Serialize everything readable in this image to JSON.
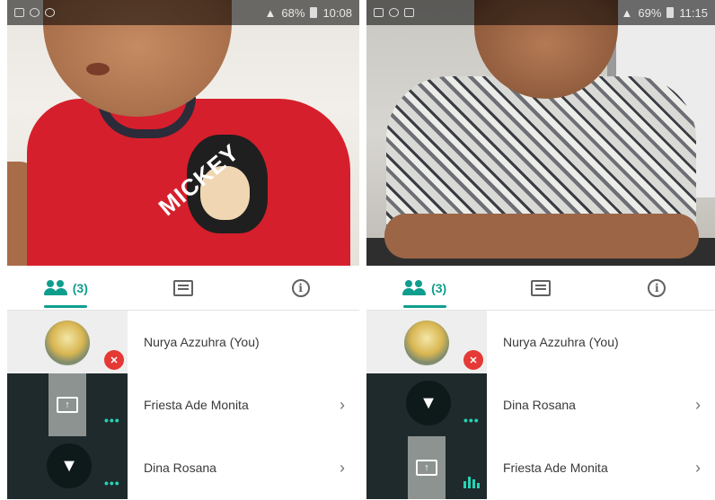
{
  "panels": [
    {
      "status": {
        "battery": "68%",
        "time": "10:08"
      },
      "tabs": {
        "participants_count": "(3)"
      },
      "participants": [
        {
          "name": "Nurya Azzuhra (You)",
          "thumb": "avatar",
          "indicator": "muted-mic"
        },
        {
          "name": "Friesta Ade Monita",
          "thumb": "screen-share",
          "indicator": "dots",
          "chevron": "›"
        },
        {
          "name": "Dina Rosana",
          "thumb": "pin",
          "indicator": "dots",
          "chevron": "›"
        }
      ],
      "video_caption": "MICKEY"
    },
    {
      "status": {
        "battery": "69%",
        "time": "11:15"
      },
      "tabs": {
        "participants_count": "(3)"
      },
      "participants": [
        {
          "name": "Nurya Azzuhra (You)",
          "thumb": "avatar",
          "indicator": "muted-mic"
        },
        {
          "name": "Dina Rosana",
          "thumb": "pin",
          "indicator": "dots",
          "chevron": "›"
        },
        {
          "name": "Friesta Ade Monita",
          "thumb": "screen-share",
          "indicator": "audio-bars",
          "chevron": "›"
        }
      ]
    }
  ],
  "colors": {
    "accent": "#0f9d8e",
    "muted": "#e53935",
    "tile_dark": "#1f2a2c",
    "speaking": "#28d3b3"
  },
  "icons": {
    "participants": "people-icon",
    "chat": "chat-icon",
    "info": "info-icon",
    "mute": "mic-off-icon",
    "pin": "pin-icon",
    "screen": "present-screen-icon"
  },
  "glyphs": {
    "mute": "✕",
    "pin": "▼",
    "dots": "•••",
    "screen": "↑"
  }
}
